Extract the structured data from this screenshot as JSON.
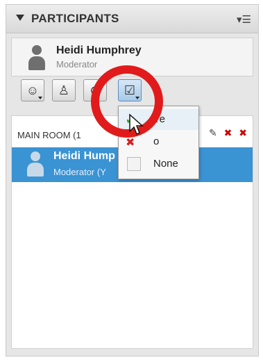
{
  "header": {
    "title": "PARTICIPANTS",
    "collapse_icon": "collapse-triangle-icon",
    "menu_icon": "panel-menu-icon"
  },
  "current_user": {
    "name": "Heidi Humphrey",
    "role": "Moderator",
    "avatar_icon": "user-avatar-icon"
  },
  "toolbar": [
    {
      "icon": "emoticon-icon",
      "glyph": "☺"
    },
    {
      "icon": "user-role-icon",
      "glyph": "♙"
    },
    {
      "icon": "audio-icon",
      "glyph": "⊙"
    },
    {
      "icon": "status-checkbox-icon",
      "glyph": "☑"
    }
  ],
  "room": {
    "label": "MAIN ROOM (1",
    "icons": [
      "edit-icon",
      "remove-status-icon",
      "clear-icon"
    ]
  },
  "participant_row": {
    "name": "Heidi Hump",
    "role": "Moderator (Y"
  },
  "status_menu": {
    "items": [
      {
        "label": "Ye",
        "icon": "yes-check-icon"
      },
      {
        "label": "o",
        "icon": "no-x-icon"
      },
      {
        "label": "None",
        "icon": "none-box-icon"
      }
    ]
  },
  "colors": {
    "highlight": "#3a93d3",
    "annotation": "#e11b1b",
    "panel_bg": "#e6e6e6"
  }
}
